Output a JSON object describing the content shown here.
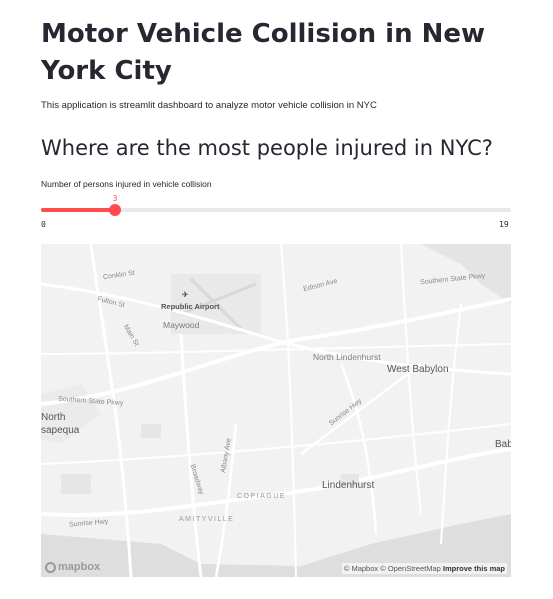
{
  "page": {
    "title": "Motor Vehicle Collision in New York City",
    "description": "This application is streamlit dashboard to analyze motor vehicle collision in NYC",
    "subheader": "Where are the most people injured in NYC?"
  },
  "slider": {
    "label": "Number of persons injured in vehicle collision",
    "value": 3,
    "value_text": "3",
    "min_text": "0",
    "max_text": "19",
    "min": 0,
    "max": 19,
    "accent_color": "#ff4b4b"
  },
  "map": {
    "streets": {
      "conklin": "Conklin St",
      "fulton": "Fulton St",
      "main": "Main St",
      "edison": "Edison Ave",
      "southern_state": "Southern State Pkwy",
      "southern_state_east": "Southern State Pkwy",
      "sunrise_e": "Sunrise Hwy",
      "sunrise_w": "Sunrise Hwy",
      "albany": "Albany Ave",
      "broadway": "Broadway"
    },
    "places": {
      "airport": "Republic Airport",
      "maywood": "Maywood",
      "north_lindenhurst": "North Lindenhurst",
      "west_babylon": "West Babylon",
      "north_massapequa_1": "North",
      "north_massapequa_2": "sapequa",
      "lindenhurst": "Lindenhurst",
      "copiague": "COPIAGUE",
      "amityville": "AMITYVILLE",
      "bab": "Bab"
    },
    "logo": "mapbox",
    "attribution": "© Mapbox © OpenStreetMap",
    "improve": "Improve this map",
    "icons": [
      "airport-icon",
      "mapbox-logo-icon"
    ]
  }
}
